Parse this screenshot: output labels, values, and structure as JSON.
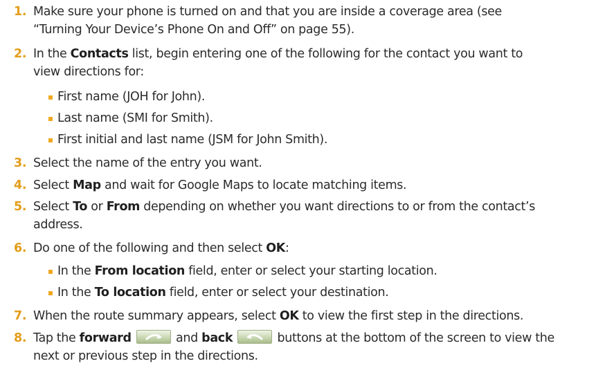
{
  "steps": [
    {
      "num": "1.",
      "lines": [
        "Make sure your phone is turned on and that you are inside a coverage area (see",
        "“Turning Your Device’s Phone On and Off” on page 55)."
      ]
    },
    {
      "num": "2.",
      "pre": "In the ",
      "bold": "Contacts",
      "post": " list, begin entering one of the following for the contact you want to",
      "line2": "view directions for:"
    },
    {
      "num": "3.",
      "text": "Select the name of the entry you want."
    },
    {
      "num": "4.",
      "pre": "Select ",
      "bold": "Map",
      "post": " and wait for Google Maps to locate matching items."
    },
    {
      "num": "5.",
      "pre": "Select ",
      "bold": "To",
      "mid": " or ",
      "bold2": "From",
      "post": " depending on whether you want directions to or from the contact’s",
      "line2": "address."
    },
    {
      "num": "6.",
      "pre": "Do one of the following and then select ",
      "bold": "OK",
      "post": ":"
    },
    {
      "num": "7.",
      "pre": "When the route summary appears, select ",
      "bold": "OK",
      "post": " to view the first step in the directions."
    },
    {
      "num": "8.",
      "pre": "Tap the ",
      "bold": "forward",
      "mid": " and ",
      "bold2": "back",
      "post": " buttons at the bottom of the screen to view the",
      "line2": "next or previous step in the directions."
    }
  ],
  "step2_bullets": [
    "First name (JOH for John).",
    "Last name (SMI for Smith).",
    "First initial and last name (JSM for John Smith)."
  ],
  "step6_bullets": [
    {
      "pre": "In the ",
      "bold": "From location",
      "post": " field, enter or select your starting location."
    },
    {
      "pre": "In the ",
      "bold": "To location",
      "post": " field, enter or select your destination."
    }
  ],
  "icons": {
    "forward": "forward-arrow-icon",
    "back": "back-arrow-icon"
  },
  "colors": {
    "number": "#e39d1a",
    "bullet": "#f0a81f",
    "text": "#2b2b2b"
  }
}
